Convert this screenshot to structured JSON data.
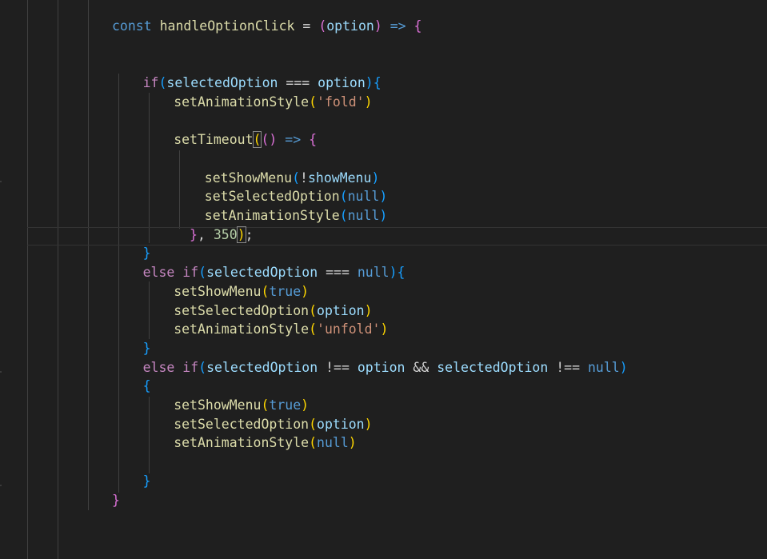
{
  "editor": {
    "language": "javascript",
    "cursor": {
      "line": 12,
      "column": 9
    },
    "lines": [
      {
        "indent": 0,
        "tokens": [
          {
            "text": "const",
            "kind": "keyword"
          },
          {
            "text": " ",
            "kind": "plain"
          },
          {
            "text": "handleOptionClick",
            "kind": "function"
          },
          {
            "text": " = ",
            "kind": "plain"
          },
          {
            "text": "(",
            "kind": "bracket-2"
          },
          {
            "text": "option",
            "kind": "variable"
          },
          {
            "text": ")",
            "kind": "bracket-2"
          },
          {
            "text": " ",
            "kind": "plain"
          },
          {
            "text": "=>",
            "kind": "keyword"
          },
          {
            "text": " ",
            "kind": "plain"
          },
          {
            "text": "{",
            "kind": "bracket-2"
          }
        ]
      },
      {
        "indent": 0,
        "tokens": []
      },
      {
        "indent": 0,
        "tokens": []
      },
      {
        "indent": 1,
        "tokens": [
          {
            "text": "if",
            "kind": "control"
          },
          {
            "text": "(",
            "kind": "bracket-3"
          },
          {
            "text": "selectedOption",
            "kind": "variable"
          },
          {
            "text": " === ",
            "kind": "plain"
          },
          {
            "text": "option",
            "kind": "variable"
          },
          {
            "text": ")",
            "kind": "bracket-3"
          },
          {
            "text": "{",
            "kind": "bracket-3"
          }
        ]
      },
      {
        "indent": 2,
        "tokens": [
          {
            "text": "setAnimationStyle",
            "kind": "function"
          },
          {
            "text": "(",
            "kind": "bracket-1"
          },
          {
            "text": "'fold'",
            "kind": "string"
          },
          {
            "text": ")",
            "kind": "bracket-1"
          }
        ]
      },
      {
        "indent": 0,
        "tokens": []
      },
      {
        "indent": 2,
        "tokens": [
          {
            "text": "setTimeout",
            "kind": "function"
          },
          {
            "text": "(",
            "kind": "bracket-match"
          },
          {
            "text": "(",
            "kind": "bracket-2"
          },
          {
            "text": ")",
            "kind": "bracket-2"
          },
          {
            "text": " ",
            "kind": "plain"
          },
          {
            "text": "=>",
            "kind": "keyword"
          },
          {
            "text": " ",
            "kind": "plain"
          },
          {
            "text": "{",
            "kind": "bracket-2"
          }
        ]
      },
      {
        "indent": 0,
        "tokens": []
      },
      {
        "indent": 3,
        "tokens": [
          {
            "text": "setShowMenu",
            "kind": "function"
          },
          {
            "text": "(",
            "kind": "bracket-3"
          },
          {
            "text": "!",
            "kind": "plain"
          },
          {
            "text": "showMenu",
            "kind": "variable"
          },
          {
            "text": ")",
            "kind": "bracket-3"
          }
        ]
      },
      {
        "indent": 3,
        "tokens": [
          {
            "text": "setSelectedOption",
            "kind": "function"
          },
          {
            "text": "(",
            "kind": "bracket-3"
          },
          {
            "text": "null",
            "kind": "literal"
          },
          {
            "text": ")",
            "kind": "bracket-3"
          }
        ]
      },
      {
        "indent": 3,
        "tokens": [
          {
            "text": "setAnimationStyle",
            "kind": "function"
          },
          {
            "text": "(",
            "kind": "bracket-3"
          },
          {
            "text": "null",
            "kind": "literal"
          },
          {
            "text": ")",
            "kind": "bracket-3"
          }
        ]
      },
      {
        "indent": 2,
        "tokens": [
          {
            "text": "  }",
            "kind": "bracket-2"
          },
          {
            "text": ", ",
            "kind": "plain"
          },
          {
            "text": "350",
            "kind": "number"
          },
          {
            "text": ")",
            "kind": "bracket-match"
          },
          {
            "text": ";",
            "kind": "plain"
          }
        ]
      },
      {
        "indent": 1,
        "tokens": [
          {
            "text": "}",
            "kind": "bracket-3"
          }
        ]
      },
      {
        "indent": 1,
        "tokens": [
          {
            "text": "else",
            "kind": "control"
          },
          {
            "text": " ",
            "kind": "plain"
          },
          {
            "text": "if",
            "kind": "control"
          },
          {
            "text": "(",
            "kind": "bracket-3"
          },
          {
            "text": "selectedOption",
            "kind": "variable"
          },
          {
            "text": " === ",
            "kind": "plain"
          },
          {
            "text": "null",
            "kind": "literal"
          },
          {
            "text": ")",
            "kind": "bracket-3"
          },
          {
            "text": "{",
            "kind": "bracket-3"
          }
        ]
      },
      {
        "indent": 2,
        "tokens": [
          {
            "text": "setShowMenu",
            "kind": "function"
          },
          {
            "text": "(",
            "kind": "bracket-1"
          },
          {
            "text": "true",
            "kind": "literal"
          },
          {
            "text": ")",
            "kind": "bracket-1"
          }
        ]
      },
      {
        "indent": 2,
        "tokens": [
          {
            "text": "setSelectedOption",
            "kind": "function"
          },
          {
            "text": "(",
            "kind": "bracket-1"
          },
          {
            "text": "option",
            "kind": "variable"
          },
          {
            "text": ")",
            "kind": "bracket-1"
          }
        ]
      },
      {
        "indent": 2,
        "tokens": [
          {
            "text": "setAnimationStyle",
            "kind": "function"
          },
          {
            "text": "(",
            "kind": "bracket-1"
          },
          {
            "text": "'unfold'",
            "kind": "string"
          },
          {
            "text": ")",
            "kind": "bracket-1"
          }
        ]
      },
      {
        "indent": 1,
        "tokens": [
          {
            "text": "}",
            "kind": "bracket-3"
          }
        ]
      },
      {
        "indent": 1,
        "tokens": [
          {
            "text": "else",
            "kind": "control"
          },
          {
            "text": " ",
            "kind": "plain"
          },
          {
            "text": "if",
            "kind": "control"
          },
          {
            "text": "(",
            "kind": "bracket-3"
          },
          {
            "text": "selectedOption",
            "kind": "variable"
          },
          {
            "text": " !== ",
            "kind": "plain"
          },
          {
            "text": "option",
            "kind": "variable"
          },
          {
            "text": " && ",
            "kind": "plain"
          },
          {
            "text": "selectedOption",
            "kind": "variable"
          },
          {
            "text": " !== ",
            "kind": "plain"
          },
          {
            "text": "null",
            "kind": "literal"
          },
          {
            "text": ")",
            "kind": "bracket-3"
          }
        ]
      },
      {
        "indent": 1,
        "tokens": [
          {
            "text": "{",
            "kind": "bracket-3"
          }
        ]
      },
      {
        "indent": 2,
        "tokens": [
          {
            "text": "setShowMenu",
            "kind": "function"
          },
          {
            "text": "(",
            "kind": "bracket-1"
          },
          {
            "text": "true",
            "kind": "literal"
          },
          {
            "text": ")",
            "kind": "bracket-1"
          }
        ]
      },
      {
        "indent": 2,
        "tokens": [
          {
            "text": "setSelectedOption",
            "kind": "function"
          },
          {
            "text": "(",
            "kind": "bracket-1"
          },
          {
            "text": "option",
            "kind": "variable"
          },
          {
            "text": ")",
            "kind": "bracket-1"
          }
        ]
      },
      {
        "indent": 2,
        "tokens": [
          {
            "text": "setAnimationStyle",
            "kind": "function"
          },
          {
            "text": "(",
            "kind": "bracket-1"
          },
          {
            "text": "null",
            "kind": "literal"
          },
          {
            "text": ")",
            "kind": "bracket-1"
          }
        ]
      },
      {
        "indent": 0,
        "tokens": []
      },
      {
        "indent": 1,
        "tokens": [
          {
            "text": "}",
            "kind": "bracket-3"
          }
        ]
      },
      {
        "indent": 0,
        "tokens": [
          {
            "text": "}",
            "kind": "bracket-2"
          }
        ]
      }
    ]
  },
  "theme": {
    "background": "#1f1f1f",
    "keyword": "#569cd6",
    "control": "#c586c0",
    "function": "#dcdcaa",
    "variable": "#9cdcfe",
    "string": "#ce9178",
    "number": "#b5cea8",
    "bracket_1": "#ffd700",
    "bracket_2": "#da70d6",
    "bracket_3": "#179fff"
  }
}
